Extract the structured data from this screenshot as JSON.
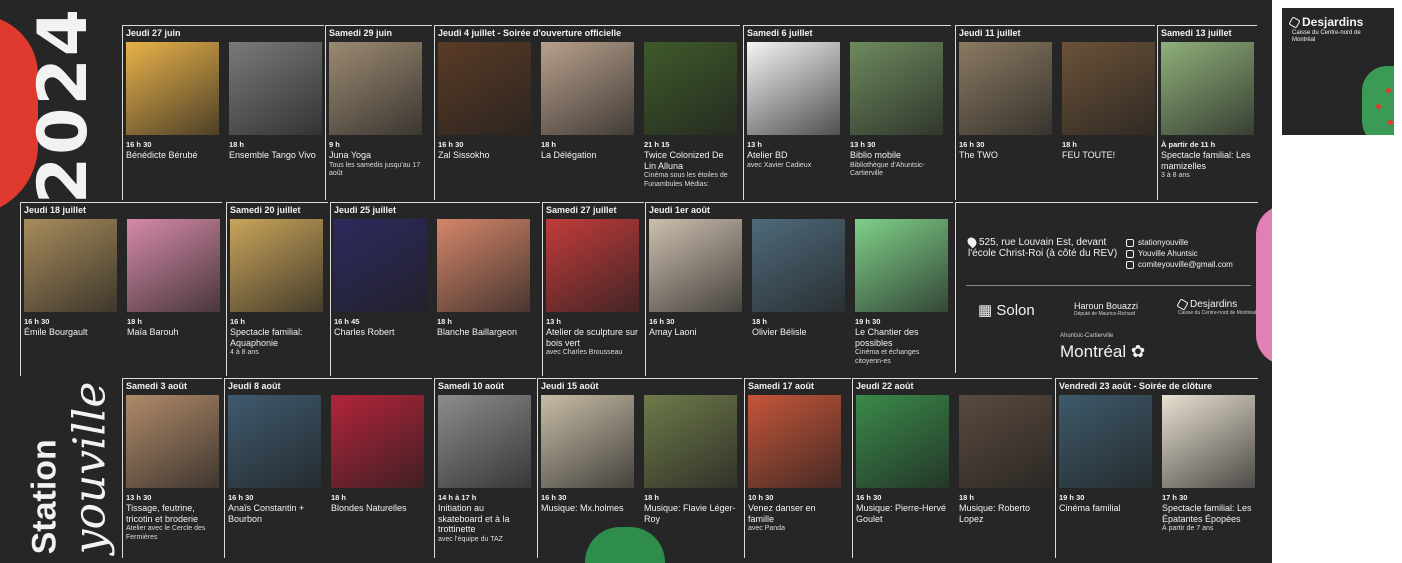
{
  "year": "2024",
  "brand": {
    "line1": "Station",
    "line2": "youville"
  },
  "groups": [
    {
      "id": "g1",
      "header": "Jeudi 27 juin",
      "events": [
        {
          "time": "16 h 30",
          "title": "Bénédicte Bérubé",
          "sub": "",
          "color": "#e9b24a"
        },
        {
          "time": "18 h",
          "title": "Ensemble Tango Vivo",
          "sub": "",
          "color": "#7a7a7a"
        }
      ]
    },
    {
      "id": "g2",
      "header": "Samedi 29 juin",
      "events": [
        {
          "time": "9 h",
          "title": "Juna Yoga",
          "sub": "Tous les samedis jusqu'au 17 août",
          "color": "#9c8a72"
        }
      ]
    },
    {
      "id": "g3",
      "header": "Jeudi 4 juillet - Soirée d'ouverture officielle",
      "events": [
        {
          "time": "16 h 30",
          "title": "Zal Sissokho",
          "sub": "",
          "color": "#5a3b26"
        },
        {
          "time": "18 h",
          "title": "La Délégation",
          "sub": "",
          "color": "#b8a08c"
        },
        {
          "time": "21 h 15",
          "title": "Twice Colonized De Lin Alluna",
          "sub": "Cinéma sous les étoiles de Funambules Médias:",
          "color": "#3f5a2a"
        }
      ]
    },
    {
      "id": "g4",
      "header": "Samedi 6 juillet",
      "events": [
        {
          "time": "13 h",
          "title": "Atelier BD",
          "sub": "avec Xavier Cadieux",
          "color": "#f4f4f4"
        },
        {
          "time": "13 h 30",
          "title": "Biblio mobile",
          "sub": "Bibliothèque d'Ahuntsic-Cartierville",
          "color": "#6e8a5e"
        }
      ]
    },
    {
      "id": "g5",
      "header": "Jeudi 11 juillet",
      "events": [
        {
          "time": "16 h 30",
          "title": "The TWO",
          "sub": "",
          "color": "#8a7a62"
        },
        {
          "time": "18 h",
          "title": "FEU TOUTE!",
          "sub": "",
          "color": "#6b5238"
        }
      ]
    },
    {
      "id": "g6",
      "header": "Samedi 13 juillet",
      "events": [
        {
          "time": "À partir de 11 h",
          "title": "Spectacle familial: Les mamizelles",
          "sub": "3 à 8 ans",
          "color": "#8fb07a"
        }
      ]
    },
    {
      "id": "g7",
      "header": "Jeudi 18 juillet",
      "events": [
        {
          "time": "16 h 30",
          "title": "Émile Bourgault",
          "sub": "",
          "color": "#a88c5c"
        },
        {
          "time": "18 h",
          "title": "Maïa Barouh",
          "sub": "",
          "color": "#d68aa8"
        }
      ]
    },
    {
      "id": "g8",
      "header": "Samedi 20 juillet",
      "events": [
        {
          "time": "16 h",
          "title": "Spectacle familial: Aquaphonie",
          "sub": "4 à 8 ans",
          "color": "#c9a45a"
        }
      ]
    },
    {
      "id": "g9",
      "header": "Jeudi 25 juillet",
      "events": [
        {
          "time": "16 h 45",
          "title": "Charles Robert",
          "sub": "",
          "color": "#2d2a5e"
        },
        {
          "time": "18 h",
          "title": "Blanche Baillargeon",
          "sub": "",
          "color": "#d5866a"
        }
      ]
    },
    {
      "id": "g10",
      "header": "Samedi 27 juillet",
      "events": [
        {
          "time": "13 h",
          "title": "Atelier de sculpture sur bois vert",
          "sub": "avec Charles Brousseau",
          "color": "#c23b3b"
        }
      ]
    },
    {
      "id": "g11",
      "header": "Jeudi 1er août",
      "events": [
        {
          "time": "16 h 30",
          "title": "Amay Laoni",
          "sub": "",
          "color": "#cdbfae"
        },
        {
          "time": "18 h",
          "title": "Olivier Bélisle",
          "sub": "",
          "color": "#4f6a7a"
        },
        {
          "time": "19 h 30",
          "title": "Le Chantier des possibles",
          "sub": "Cinéma et échanges citoyenn-es",
          "color": "#7fd089"
        }
      ]
    },
    {
      "id": "g12",
      "header": "Samedi 3 août",
      "events": [
        {
          "time": "13 h 30",
          "title": "Tissage, feutrine, tricotin et broderie",
          "sub": "Atelier avec le Cercle des Fermières",
          "color": "#b08a6a"
        }
      ]
    },
    {
      "id": "g13",
      "header": "Jeudi 8 août",
      "events": [
        {
          "time": "16 h 30",
          "title": "Anaïs Constantin + Bourbon",
          "sub": "",
          "color": "#3f5a6e"
        },
        {
          "time": "18 h",
          "title": "Blondes Naturelles",
          "sub": "",
          "color": "#b3243a"
        }
      ]
    },
    {
      "id": "g14",
      "header": "Samedi 10 août",
      "events": [
        {
          "time": "14 h à 17 h",
          "title": "Initiation au skateboard et à la trottinette",
          "sub": "avec l'équipe du TAZ",
          "color": "#8c8c8c"
        }
      ]
    },
    {
      "id": "g15",
      "header": "Jeudi 15 août",
      "events": [
        {
          "time": "16 h 30",
          "title": "Musique: Mx.holmes",
          "sub": "",
          "color": "#c7bca6"
        },
        {
          "time": "18 h",
          "title": "Musique: Flavie Léger-Roy",
          "sub": "",
          "color": "#6e7a4a"
        }
      ]
    },
    {
      "id": "g16",
      "header": "Samedi 17 août",
      "events": [
        {
          "time": "10 h 30",
          "title": "Venez danser en famille",
          "sub": "avec Panda",
          "color": "#c6553a"
        }
      ]
    },
    {
      "id": "g17",
      "header": "Jeudi 22 août",
      "events": [
        {
          "time": "16 h 30",
          "title": "Musique: Pierre-Hervé Goulet",
          "sub": "",
          "color": "#3a8a4a"
        },
        {
          "time": "18 h",
          "title": "Musique: Roberto Lopez",
          "sub": "",
          "color": "#5a4a3e"
        }
      ]
    },
    {
      "id": "g18",
      "header": "Vendredi 23 août - Soirée de clôture",
      "events": [
        {
          "time": "19 h 30",
          "title": "Cinéma familial",
          "sub": "",
          "color": "#3e5a6a"
        },
        {
          "time": "17 h 30",
          "title": "Spectacle familial: Les Épatantes Épopées",
          "sub": "À partir de 7 ans",
          "color": "#e8e0d0"
        }
      ]
    }
  ],
  "info": {
    "address": "525, rue Louvain Est, devant l'école Christ-Roi (à côté du REV)",
    "socials": [
      "stationyouville",
      "Youville Ahuntsic",
      "comiteyouville@gmail.com"
    ],
    "sponsors": {
      "solon": "Solon",
      "haroun": "Haroun Bouazzi",
      "haroun_sub": "Député de Maurice-Richard",
      "desjardins": "Desjardins",
      "desjardins_sub": "Caisse du Centre-nord de Montréal",
      "ahuntsic": "Ahuntsic-Cartierville",
      "montreal": "Montréal"
    }
  },
  "card": {
    "name": "Desjardins",
    "sub": "Caisse du Centre-nord de Montréal"
  }
}
